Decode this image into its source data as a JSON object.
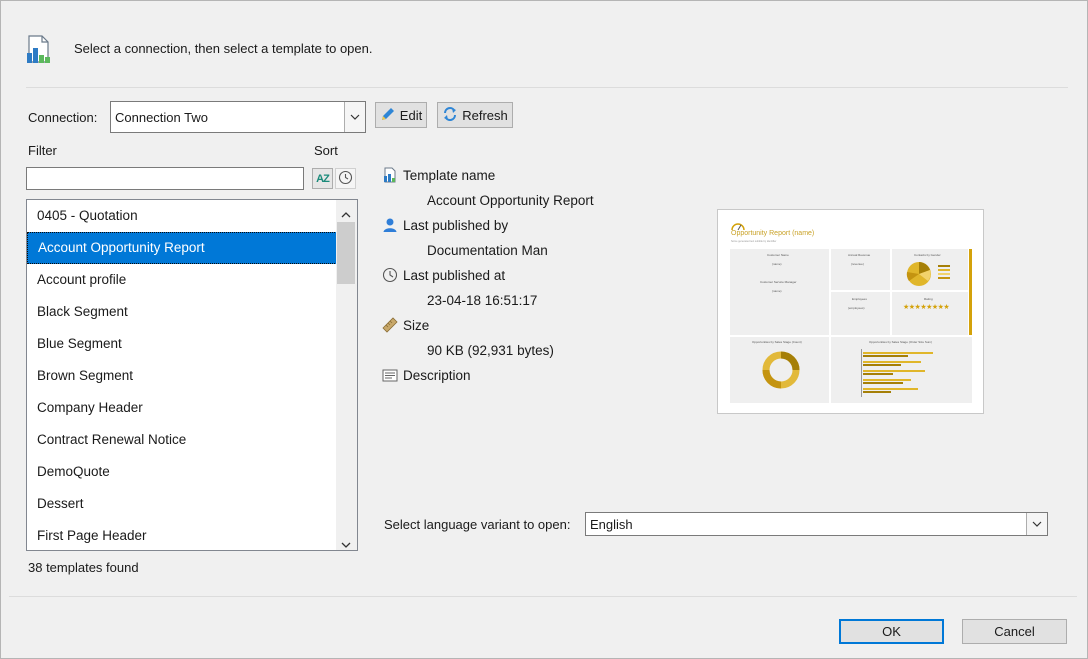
{
  "header": {
    "message": "Select a connection, then select a template to open."
  },
  "connection": {
    "label": "Connection:",
    "value": "Connection Two"
  },
  "toolbar": {
    "edit_label": "Edit",
    "refresh_label": "Refresh"
  },
  "filter": {
    "label": "Filter",
    "value": ""
  },
  "sort": {
    "label": "Sort",
    "az_label": "AZ"
  },
  "templates": {
    "items": [
      "0405 - Quotation",
      "Account Opportunity Report",
      "Account profile",
      "Black Segment",
      "Blue Segment",
      "Brown Segment",
      "Company Header",
      "Contract Renewal Notice",
      "DemoQuote",
      "Dessert",
      "First Page Header"
    ],
    "selected_index": 1,
    "count_text": "38 templates found"
  },
  "details": {
    "template_name_label": "Template name",
    "template_name_value": "Account Opportunity Report",
    "published_by_label": "Last published by",
    "published_by_value": "Documentation Man",
    "published_at_label": "Last published at",
    "published_at_value": "23-04-18 16:51:17",
    "size_label": "Size",
    "size_value": "90 KB (92,931 bytes)",
    "description_label": "Description"
  },
  "preview": {
    "title": "Opportunity Report (name)",
    "subtitle": "Some generated text subtitle by identifier",
    "tiles": {
      "customer_name": "Customer Name",
      "customer_name_value": "(name)",
      "account_revenue": "Annual Revenue",
      "account_revenue_value": "(revenue)",
      "contacts_by_gender": "Contacts by Gender",
      "service_manager": "Customer Service Manager",
      "service_manager_value": "(name)",
      "employees": "Employees",
      "employees_value": "(employees)",
      "rating": "Rating",
      "stage_count": "Opportunities by Sales Stage (Count)",
      "stage_size": "Opportunities by Sales Stage (Order Size Sum)"
    }
  },
  "language": {
    "label": "Select language variant to open:",
    "value": "English"
  },
  "footer": {
    "ok_label": "OK",
    "cancel_label": "Cancel"
  },
  "colors": {
    "accent": "#0078d7",
    "preview_gold": "#d4a20a"
  }
}
